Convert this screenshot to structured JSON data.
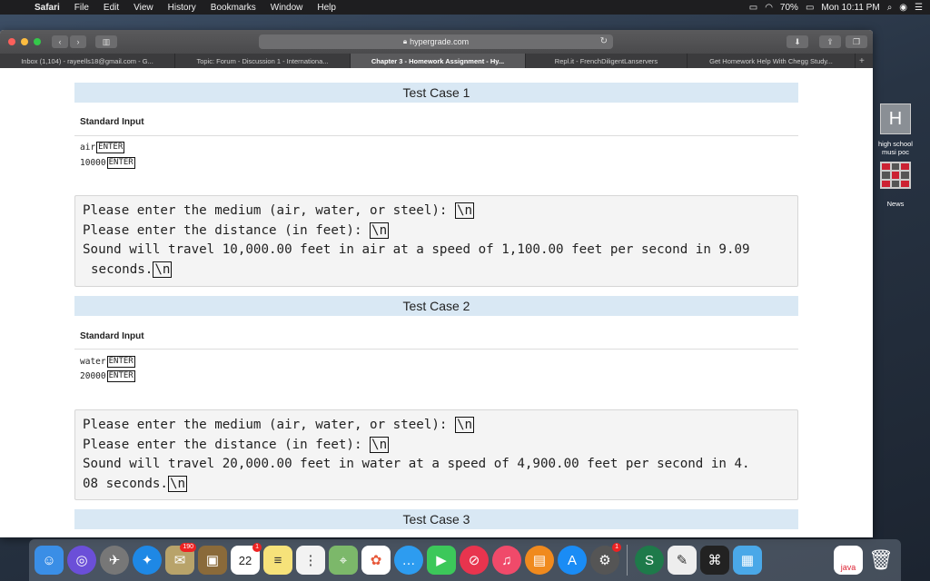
{
  "menubar": {
    "app": "Safari",
    "items": [
      "File",
      "Edit",
      "View",
      "History",
      "Bookmarks",
      "Window",
      "Help"
    ],
    "battery": "70%",
    "clock": "Mon 10:11 PM"
  },
  "browser": {
    "url": "hypergrade.com",
    "tabs": [
      "Inbox (1,104) - rayeells18@gmail.com - G...",
      "Topic: Forum - Discussion 1 - Internationa...",
      "Chapter 3 - Homework Assignment - Hy...",
      "Repl.it - FrenchDiligentLanservers",
      "Get Homework Help With Chegg Study..."
    ],
    "active_tab": 2,
    "new_tab": "+"
  },
  "page": {
    "test_cases": [
      {
        "title": "Test Case 1",
        "std_label": "Standard Input",
        "inputs": [
          {
            "value": "air",
            "key": "ENTER"
          },
          {
            "value": "10000",
            "key": "ENTER"
          }
        ],
        "output": {
          "line1": "Please enter the medium (air, water, or steel): ",
          "line2": "Please enter the distance (in feet): ",
          "line3": "Sound will travel 10,000.00 feet in air at a speed of 1,100.00 feet per second in 9.09",
          "line4": "seconds.",
          "newline": "\\n"
        }
      },
      {
        "title": "Test Case 2",
        "std_label": "Standard Input",
        "inputs": [
          {
            "value": "water",
            "key": "ENTER"
          },
          {
            "value": "20000",
            "key": "ENTER"
          }
        ],
        "output": {
          "line1": "Please enter the medium (air, water, or steel): ",
          "line2": "Please enter the distance (in feet): ",
          "line3": "Sound will travel 20,000.00 feet in water at a speed of 4,900.00 feet per second in 4.",
          "line4": "08 seconds.",
          "newline": "\\n"
        }
      },
      {
        "title": "Test Case 3"
      }
    ]
  },
  "side_widget": {
    "letter": "H",
    "caption": "high school musi poc",
    "news": "News"
  },
  "dock": {
    "badges": {
      "mail": "190",
      "calendar": "1",
      "appstore": "1"
    },
    "calendar_day": "22",
    "file_label": "java"
  }
}
